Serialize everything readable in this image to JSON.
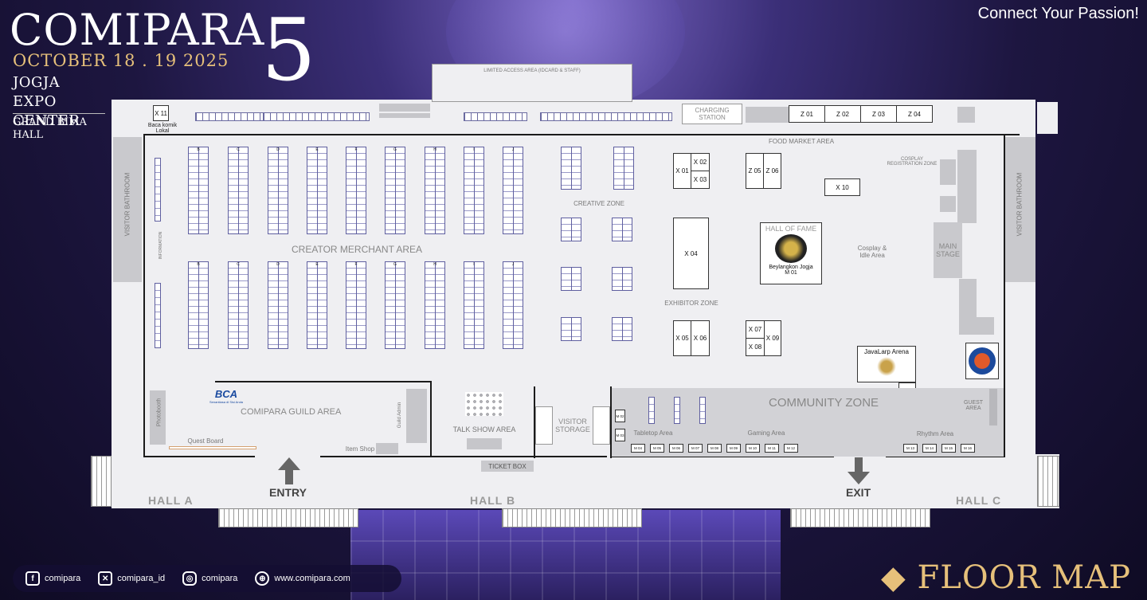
{
  "header": {
    "title": "COMIPARA",
    "edition": "5",
    "date": "OCTOBER  18 . 19  2025",
    "venue": "JOGJA EXPO CENTER",
    "hall": "GRAND BIMA HALL",
    "tagline": "Connect Your Passion!"
  },
  "map": {
    "limited_access": "LIMITED ACCESS AREA (IDCARD & STAFF)",
    "charging_station": "CHARGING STATION",
    "food_market": "FOOD MARKET AREA",
    "cosplay_registration": "COSPLAY REGISTRATION ZONE",
    "creative_zone": "CREATIVE ZONE",
    "creator_merchant": "CREATOR MERCHANT AREA",
    "hall_of_fame": "HALL OF FAME",
    "hall_of_fame_name": "Beylangkon Jogja",
    "hall_of_fame_code": "M 01",
    "exhibitor_zone": "EXHIBITOR ZONE",
    "cosplay_idle": "Cosplay & Idle Area",
    "main_stage": "MAIN STAGE",
    "javalarp": "JavaLarp Arena",
    "community_zone": "COMMUNITY ZONE",
    "guest_area": "GUEST AREA",
    "tabletop": "Tabletop Area",
    "gaming": "Gaming Area",
    "rhythm": "Rhythm Area",
    "guild_area": "COMIPARA GUILD AREA",
    "guild_admin": "Guild Admin",
    "photobooth": "Photobooth",
    "quest_board": "Quest Board",
    "item_shop": "Item Shop",
    "talk_show": "TALK SHOW AREA",
    "visitor_storage": "VISITOR STORAGE",
    "ticket_box": "TICKET BOX",
    "visitor_bathroom": "VISITOR BATHROOM",
    "information": "INFORMATION",
    "baca_komik": "Baca komik Lokal",
    "entry": "ENTRY",
    "exit": "EXIT",
    "hall_a": "HALL A",
    "hall_b": "HALL B",
    "hall_c": "HALL C",
    "sponsor_bca": "BCA",
    "sponsor_bca_tag": "Senantiasa di Sisi Anda",
    "x_booths": [
      "X 11",
      "X 01",
      "X 02",
      "X 03",
      "X 04",
      "X 05",
      "X 06",
      "X 07",
      "X 08",
      "X 09",
      "X 10"
    ],
    "z_top": [
      "Z 01",
      "Z 02",
      "Z 03",
      "Z 04"
    ],
    "z_mid": [
      "Z 05",
      "Z 06"
    ],
    "m_booths_left": [
      "M 04",
      "M 05",
      "M 06",
      "M 07",
      "M 08",
      "M 09",
      "M 10",
      "M 11",
      "M 12"
    ],
    "m_booths_right": [
      "M 13",
      "M 14",
      "M 15",
      "M 16"
    ],
    "m_side": [
      "M 02",
      "M 03"
    ],
    "column_letters": [
      "B",
      "C",
      "D",
      "E",
      "F",
      "G",
      "H",
      "I",
      "J"
    ]
  },
  "footer": {
    "facebook": "comipara",
    "x": "comipara_id",
    "instagram": "comipara",
    "website": "www.comipara.com",
    "floor_map": "FLOOR MAP"
  }
}
